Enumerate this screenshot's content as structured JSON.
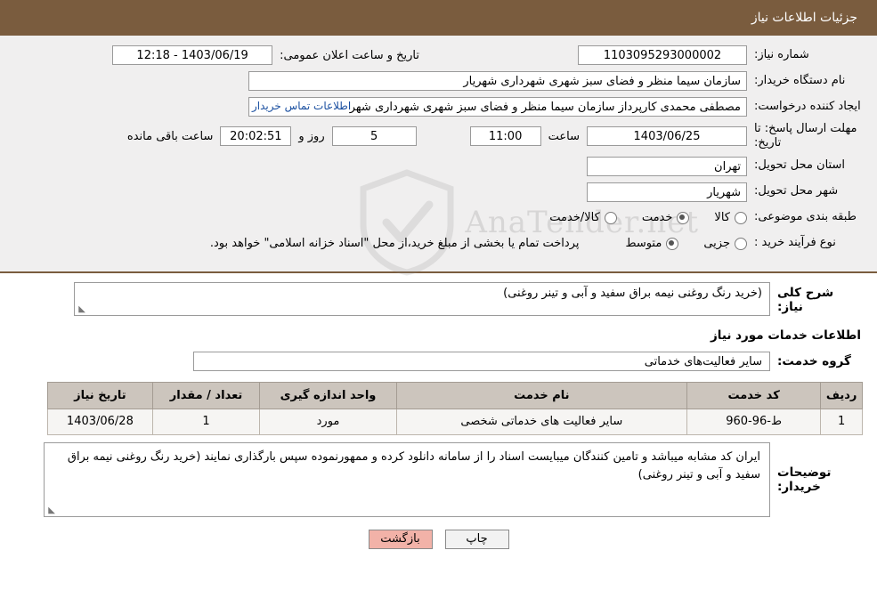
{
  "header": {
    "title": "جزئیات اطلاعات نیاز"
  },
  "details": {
    "need_number_label": "شماره نیاز:",
    "need_number_value": "1103095293000002",
    "announce_label": "تاریخ و ساعت اعلان عمومی:",
    "announce_value": "1403/06/19 - 12:18",
    "buyer_org_label": "نام دستگاه خریدار:",
    "buyer_org_value": "سازمان سیما منظر و فضای سبز شهری شهرداری شهریار",
    "requester_label": "ایجاد کننده درخواست:",
    "requester_value": "مصطفی محمدی کارپرداز سازمان سیما منظر و فضای سبز شهری شهرداری شهر",
    "contact_link": "اطلاعات تماس خریدار",
    "deadline_label": "مهلت ارسال پاسخ: تا تاریخ:",
    "deadline_date": "1403/06/25",
    "time_label": "ساعت",
    "deadline_time": "11:00",
    "days_value": "5",
    "days_label": "روز و",
    "countdown_value": "20:02:51",
    "remaining_label": "ساعت باقی مانده",
    "province_label": "استان محل تحویل:",
    "province_value": "تهران",
    "city_label": "شهر محل تحویل:",
    "city_value": "شهریار",
    "category_label": "طبقه بندی موضوعی:",
    "category_options": [
      "کالا",
      "خدمت",
      "کالا/خدمت"
    ],
    "category_selected": "خدمت",
    "purchase_type_label": "نوع فرآیند خرید :",
    "purchase_options": [
      "جزیی",
      "متوسط"
    ],
    "purchase_selected": "متوسط",
    "purchase_note": "پرداخت تمام یا بخشی از مبلغ خرید،از محل \"اسناد خزانه اسلامی\" خواهد بود."
  },
  "main": {
    "summary_label": "شرح کلی نیاز:",
    "summary_value": "(خرید رنگ روغنی نیمه براق سفید و آبی و تینر روغنی)",
    "services_title": "اطلاعات خدمات مورد نیاز",
    "group_label": "گروه خدمت:",
    "group_value": "سایر فعالیت‌های خدماتی"
  },
  "table": {
    "headers": [
      "ردیف",
      "کد خدمت",
      "نام خدمت",
      "واحد اندازه گیری",
      "تعداد / مقدار",
      "تاریخ نیاز"
    ],
    "rows": [
      {
        "row": "1",
        "code": "ط-96-960",
        "name": "سایر فعالیت های خدماتی شخصی",
        "unit": "مورد",
        "qty": "1",
        "date": "1403/06/28"
      }
    ]
  },
  "buyer_notes": {
    "label": "توضیحات خریدار:",
    "value": "ایران کد مشابه میباشد و تامین کنندگان میبایست اسناد را از سامانه دانلود کرده و ممهورنموده سپس بارگذاری نمایند (خرید رنگ روغنی نیمه براق سفید و آبی و تینر روغنی)"
  },
  "footer": {
    "print_label": "چاپ",
    "back_label": "بازگشت"
  },
  "watermark": {
    "text": "AnaTender.net"
  }
}
